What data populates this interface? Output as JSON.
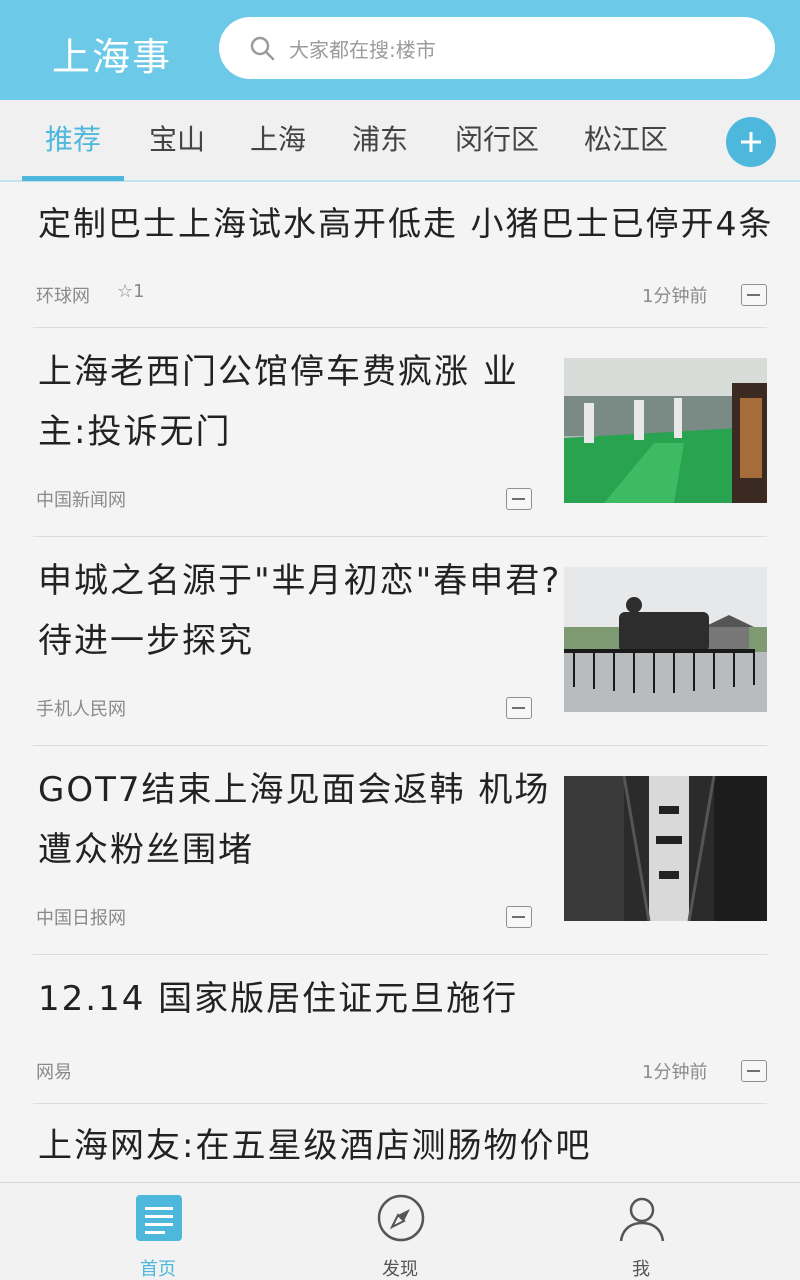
{
  "header": {
    "app_title": "上海事",
    "search_placeholder": "大家都在搜:楼市"
  },
  "tabs": [
    {
      "label": "推荐",
      "active": true
    },
    {
      "label": "宝山"
    },
    {
      "label": "上海"
    },
    {
      "label": "浦东"
    },
    {
      "label": "闵行区"
    },
    {
      "label": "松江区"
    }
  ],
  "articles": [
    {
      "title": "定制巴士上海试水高开低走 小猪巴士已停开4条",
      "source": "环球网",
      "stars": "1",
      "time": "1分钟前"
    },
    {
      "title_line1": "上海老西门公馆停车费疯涨 业",
      "title_line2": "主:投诉无门",
      "source": "中国新闻网",
      "thumbnail": "parking-garage-image"
    },
    {
      "title_line1": "申城之名源于\"芈月初恋\"春申君?",
      "title_line2": "待进一步探究",
      "source": "手机人民网",
      "thumbnail": "chariot-statue-image"
    },
    {
      "title_line1": "GOT7结束上海见面会返韩 机场",
      "title_line2": "遭众粉丝围堵",
      "source": "中国日报网",
      "thumbnail": "leather-jacket-image"
    },
    {
      "title": "12.14 国家版居住证元旦施行",
      "source": "网易",
      "time": "1分钟前"
    },
    {
      "title": "上海网友:在五星级酒店测肠物价吧"
    }
  ],
  "bottom_nav": [
    {
      "label": "首页",
      "icon": "home-list-icon",
      "active": true
    },
    {
      "label": "发现",
      "icon": "compass-icon"
    },
    {
      "label": "我",
      "icon": "user-icon"
    }
  ],
  "colors": {
    "accent": "#4db8dc",
    "header_bg": "#6cc9e8",
    "text_secondary": "#8a8a8a"
  }
}
